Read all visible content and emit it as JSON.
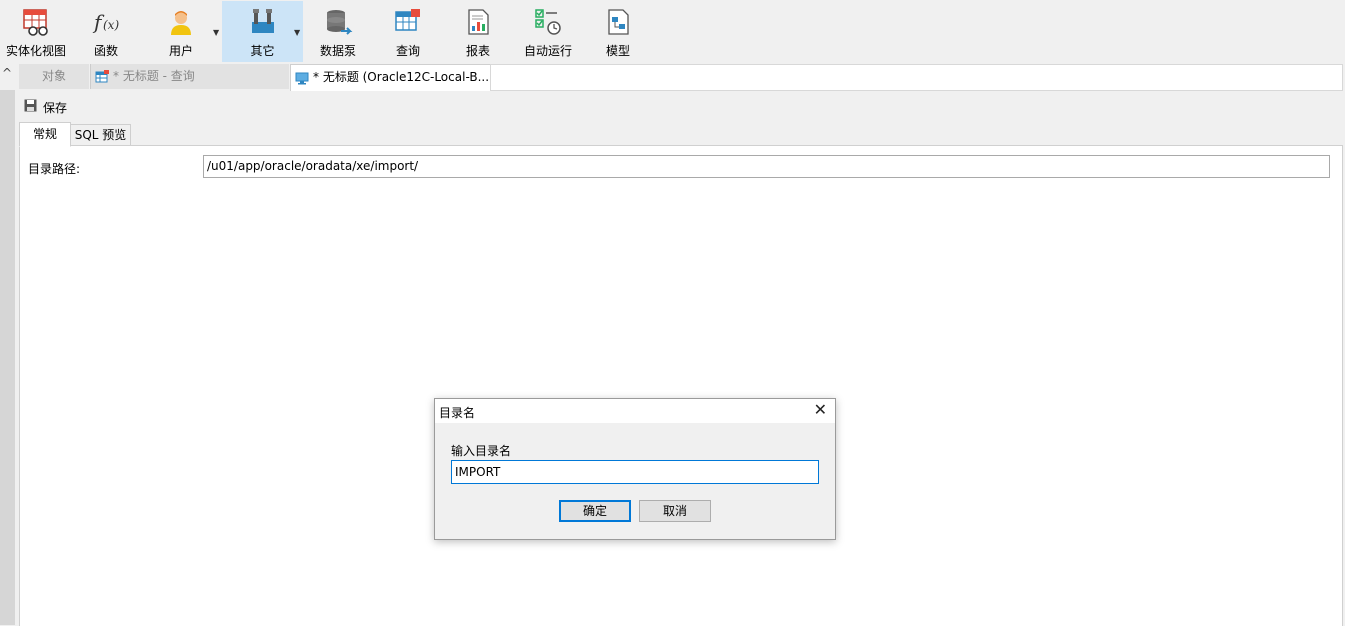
{
  "toolbar": {
    "items": [
      {
        "label": "实体化视图",
        "icon": "materialized-view-icon"
      },
      {
        "label": "函数",
        "icon": "function-icon"
      },
      {
        "label": "用户",
        "icon": "user-icon"
      },
      {
        "label": "其它",
        "icon": "tools-icon"
      },
      {
        "label": "数据泵",
        "icon": "data-pump-icon"
      },
      {
        "label": "查询",
        "icon": "query-icon"
      },
      {
        "label": "报表",
        "icon": "report-icon"
      },
      {
        "label": "自动运行",
        "icon": "automation-icon"
      },
      {
        "label": "模型",
        "icon": "model-icon"
      }
    ],
    "active_item": "其它"
  },
  "tabs": {
    "objects": "对象",
    "query": "* 无标题 - 查询",
    "directory": "* 无标题 (Oracle12C-Local-B..."
  },
  "editor": {
    "save_label": "保存",
    "subtabs": [
      "常规",
      "SQL 预览"
    ],
    "directory_path_label": "目录路径:",
    "directory_path_value": "/u01/app/oracle/oradata/xe/import/"
  },
  "dialog": {
    "title": "目录名",
    "prompt": "输入目录名",
    "input_value": "IMPORT",
    "ok_label": "确定",
    "cancel_label": "取消"
  },
  "colors": {
    "active_toolbar_bg": "#cce4f7",
    "focus_blue": "#0078d7"
  }
}
